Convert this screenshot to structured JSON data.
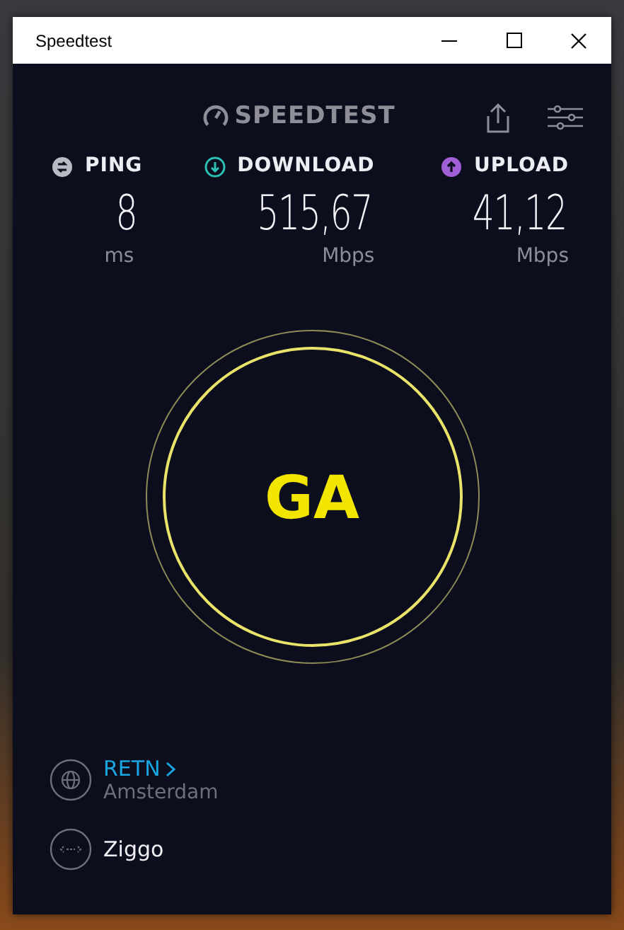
{
  "window": {
    "title": "Speedtest"
  },
  "header": {
    "logo": "SPEEDTEST"
  },
  "metrics": [
    {
      "kind": "ping",
      "label": "PING",
      "value": "8",
      "unit": "ms",
      "color": "#b9bac4"
    },
    {
      "kind": "download",
      "label": "DOWNLOAD",
      "value": "515,67",
      "unit": "Mbps",
      "color": "#2bc0b4"
    },
    {
      "kind": "upload",
      "label": "UPLOAD",
      "value": "41,12",
      "unit": "Mbps",
      "color": "#a05fd6"
    }
  ],
  "go_button": {
    "label": "GA"
  },
  "server": {
    "provider": "RETN",
    "location": "Amsterdam"
  },
  "isp": {
    "name": "Ziggo"
  }
}
